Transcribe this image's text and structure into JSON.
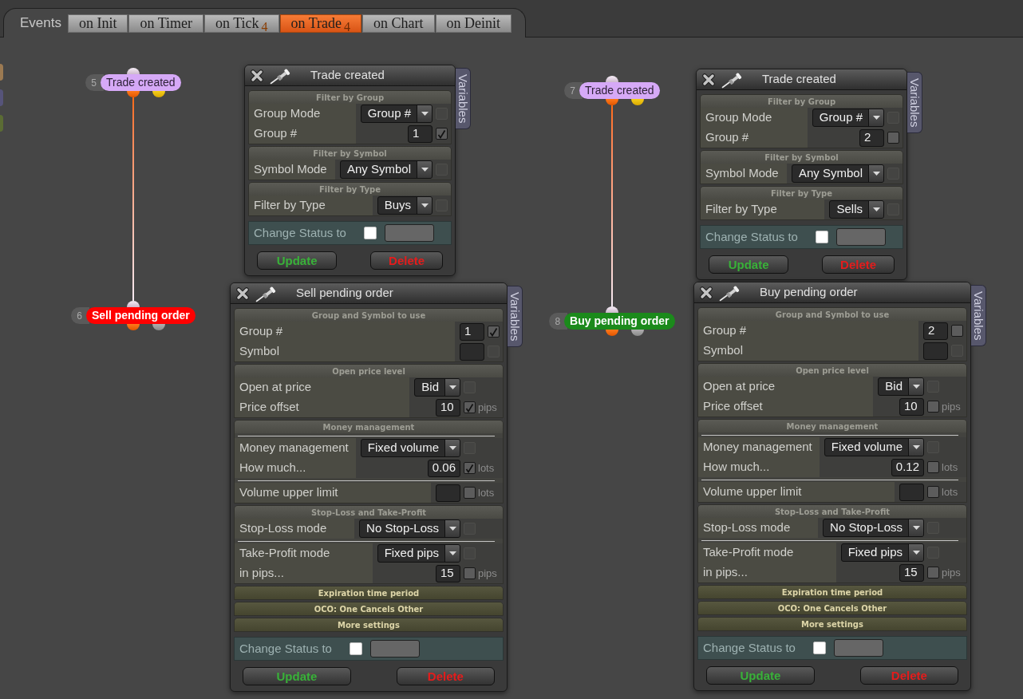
{
  "events_bar": {
    "label": "Events",
    "tabs": [
      {
        "label": "on Init",
        "selected": false
      },
      {
        "label": "on Timer",
        "selected": false
      },
      {
        "label": "on Tick",
        "badge": "4",
        "selected": false
      },
      {
        "label": "on Trade",
        "badge": "4",
        "selected": true
      },
      {
        "label": "on Chart",
        "selected": false
      },
      {
        "label": "on Deinit",
        "selected": false
      }
    ]
  },
  "offscreen_nodes": [
    {
      "color": "#9c7a52"
    },
    {
      "color": "#56547a"
    },
    {
      "color": "#5b6c34"
    }
  ],
  "flows": [
    {
      "trigger": {
        "number": "5",
        "label": "Trade created",
        "kind": "event",
        "color": "#d6a9f7"
      },
      "action": {
        "number": "6",
        "label": "Sell pending order",
        "kind": "action",
        "color": "#ff0000"
      },
      "panels": [
        {
          "title": "Trade created",
          "side_tab": "Variables",
          "sections": [
            {
              "title": "Filter by Group",
              "expanded": true,
              "groups": [
                {
                  "rule_above": false,
                  "rows": [
                    {
                      "label": "Group Mode",
                      "kind": "select",
                      "value": "Group #",
                      "checked": false
                    },
                    {
                      "label": "Group #",
                      "kind": "number",
                      "value": "1",
                      "checked": true
                    }
                  ]
                }
              ]
            },
            {
              "title": "Filter by Symbol",
              "expanded": true,
              "groups": [
                {
                  "rule_above": false,
                  "rows": [
                    {
                      "label": "Symbol Mode",
                      "kind": "select",
                      "value": "Any Symbol",
                      "checked": false
                    }
                  ]
                }
              ]
            },
            {
              "title": "Filter by Type",
              "expanded": true,
              "groups": [
                {
                  "rule_above": false,
                  "rows": [
                    {
                      "label": "Filter by Type",
                      "kind": "select",
                      "value": "Buys",
                      "checked": false
                    }
                  ]
                }
              ]
            }
          ],
          "status": {
            "label": "Change Status to",
            "checked": false
          },
          "buttons": [
            {
              "label": "Update",
              "kind": "update"
            },
            {
              "label": "Delete",
              "kind": "delete"
            }
          ]
        },
        {
          "title": "Sell pending order",
          "side_tab": "Variables",
          "sections": [
            {
              "title": "Group and Symbol to use",
              "expanded": true,
              "groups": [
                {
                  "rule_above": false,
                  "rows": [
                    {
                      "label": "Group #",
                      "kind": "number",
                      "value": "1",
                      "checked": true
                    },
                    {
                      "label": "Symbol",
                      "kind": "text",
                      "checked": false
                    }
                  ]
                }
              ]
            },
            {
              "title": "Open price level",
              "expanded": true,
              "groups": [
                {
                  "rule_above": false,
                  "rows": [
                    {
                      "label": "Open at price",
                      "kind": "select",
                      "value": "Bid",
                      "checked": false
                    },
                    {
                      "label": "Price offset",
                      "kind": "number",
                      "value": "10",
                      "unit": "pips",
                      "checked": true
                    }
                  ]
                }
              ]
            },
            {
              "title": "Money management",
              "expanded": true,
              "groups": [
                {
                  "rule_above": true,
                  "rows": [
                    {
                      "label": "Money management",
                      "kind": "select",
                      "value": "Fixed volume",
                      "checked": false
                    },
                    {
                      "label": "How much...",
                      "kind": "number",
                      "value": "0.06",
                      "unit": "lots",
                      "checked": true
                    }
                  ]
                },
                {
                  "rule_above": true,
                  "rows": [
                    {
                      "label": "Volume upper limit",
                      "kind": "number",
                      "unit": "lots",
                      "checked": false
                    }
                  ]
                }
              ]
            },
            {
              "title": "Stop-Loss and Take-Profit",
              "expanded": true,
              "groups": [
                {
                  "rule_above": false,
                  "rows": [
                    {
                      "label": "Stop-Loss mode",
                      "kind": "select",
                      "value": "No Stop-Loss",
                      "checked": false
                    }
                  ]
                },
                {
                  "rule_above": true,
                  "rows": [
                    {
                      "label": "Take-Profit mode",
                      "kind": "select",
                      "value": "Fixed pips",
                      "checked": false
                    },
                    {
                      "label": "in pips...",
                      "kind": "number",
                      "value": "15",
                      "unit": "pips",
                      "checked": false
                    }
                  ]
                }
              ]
            },
            {
              "title": "Expiration time period",
              "expanded": false
            },
            {
              "title": "OCO: One Cancels Other",
              "expanded": false
            },
            {
              "title": "More settings",
              "expanded": false
            }
          ],
          "status": {
            "label": "Change Status to",
            "checked": false
          },
          "buttons": [
            {
              "label": "Update",
              "kind": "update"
            },
            {
              "label": "Delete",
              "kind": "delete"
            }
          ]
        }
      ]
    },
    {
      "trigger": {
        "number": "7",
        "label": "Trade created",
        "kind": "event",
        "color": "#d6a9f7"
      },
      "action": {
        "number": "8",
        "label": "Buy pending order",
        "kind": "action",
        "color": "#1b8a1b"
      },
      "panels": [
        {
          "title": "Trade created",
          "side_tab": "Variables",
          "sections": [
            {
              "title": "Filter by Group",
              "expanded": true,
              "groups": [
                {
                  "rule_above": false,
                  "rows": [
                    {
                      "label": "Group Mode",
                      "kind": "select",
                      "value": "Group #",
                      "checked": false
                    },
                    {
                      "label": "Group #",
                      "kind": "number",
                      "value": "2",
                      "checked": false
                    }
                  ]
                }
              ]
            },
            {
              "title": "Filter by Symbol",
              "expanded": true,
              "groups": [
                {
                  "rule_above": false,
                  "rows": [
                    {
                      "label": "Symbol Mode",
                      "kind": "select",
                      "value": "Any Symbol",
                      "checked": false
                    }
                  ]
                }
              ]
            },
            {
              "title": "Filter by Type",
              "expanded": true,
              "groups": [
                {
                  "rule_above": false,
                  "rows": [
                    {
                      "label": "Filter by Type",
                      "kind": "select",
                      "value": "Sells",
                      "checked": false
                    }
                  ]
                }
              ]
            }
          ],
          "status": {
            "label": "Change Status to",
            "checked": false
          },
          "buttons": [
            {
              "label": "Update",
              "kind": "update"
            },
            {
              "label": "Delete",
              "kind": "delete"
            }
          ]
        },
        {
          "title": "Buy pending order",
          "side_tab": "Variables",
          "sections": [
            {
              "title": "Group and Symbol to use",
              "expanded": true,
              "groups": [
                {
                  "rule_above": false,
                  "rows": [
                    {
                      "label": "Group #",
                      "kind": "number",
                      "value": "2",
                      "checked": false
                    },
                    {
                      "label": "Symbol",
                      "kind": "text",
                      "checked": false
                    }
                  ]
                }
              ]
            },
            {
              "title": "Open price level",
              "expanded": true,
              "groups": [
                {
                  "rule_above": false,
                  "rows": [
                    {
                      "label": "Open at price",
                      "kind": "select",
                      "value": "Bid",
                      "checked": false
                    },
                    {
                      "label": "Price offset",
                      "kind": "number",
                      "value": "10",
                      "unit": "pips",
                      "checked": false
                    }
                  ]
                }
              ]
            },
            {
              "title": "Money management",
              "expanded": true,
              "groups": [
                {
                  "rule_above": true,
                  "rows": [
                    {
                      "label": "Money management",
                      "kind": "select",
                      "value": "Fixed volume",
                      "checked": false
                    },
                    {
                      "label": "How much...",
                      "kind": "number",
                      "value": "0.12",
                      "unit": "lots",
                      "checked": false
                    }
                  ]
                },
                {
                  "rule_above": true,
                  "rows": [
                    {
                      "label": "Volume upper limit",
                      "kind": "number",
                      "unit": "lots",
                      "checked": false
                    }
                  ]
                }
              ]
            },
            {
              "title": "Stop-Loss and Take-Profit",
              "expanded": true,
              "groups": [
                {
                  "rule_above": false,
                  "rows": [
                    {
                      "label": "Stop-Loss mode",
                      "kind": "select",
                      "value": "No Stop-Loss",
                      "checked": false
                    }
                  ]
                },
                {
                  "rule_above": true,
                  "rows": [
                    {
                      "label": "Take-Profit mode",
                      "kind": "select",
                      "value": "Fixed pips",
                      "checked": false
                    },
                    {
                      "label": "in pips...",
                      "kind": "number",
                      "value": "15",
                      "unit": "pips",
                      "checked": false
                    }
                  ]
                }
              ]
            },
            {
              "title": "Expiration time period",
              "expanded": false
            },
            {
              "title": "OCO: One Cancels Other",
              "expanded": false
            },
            {
              "title": "More settings",
              "expanded": false
            }
          ],
          "status": {
            "label": "Change Status to",
            "checked": false
          },
          "buttons": [
            {
              "label": "Update",
              "kind": "update"
            },
            {
              "label": "Delete",
              "kind": "delete"
            }
          ]
        }
      ]
    }
  ]
}
